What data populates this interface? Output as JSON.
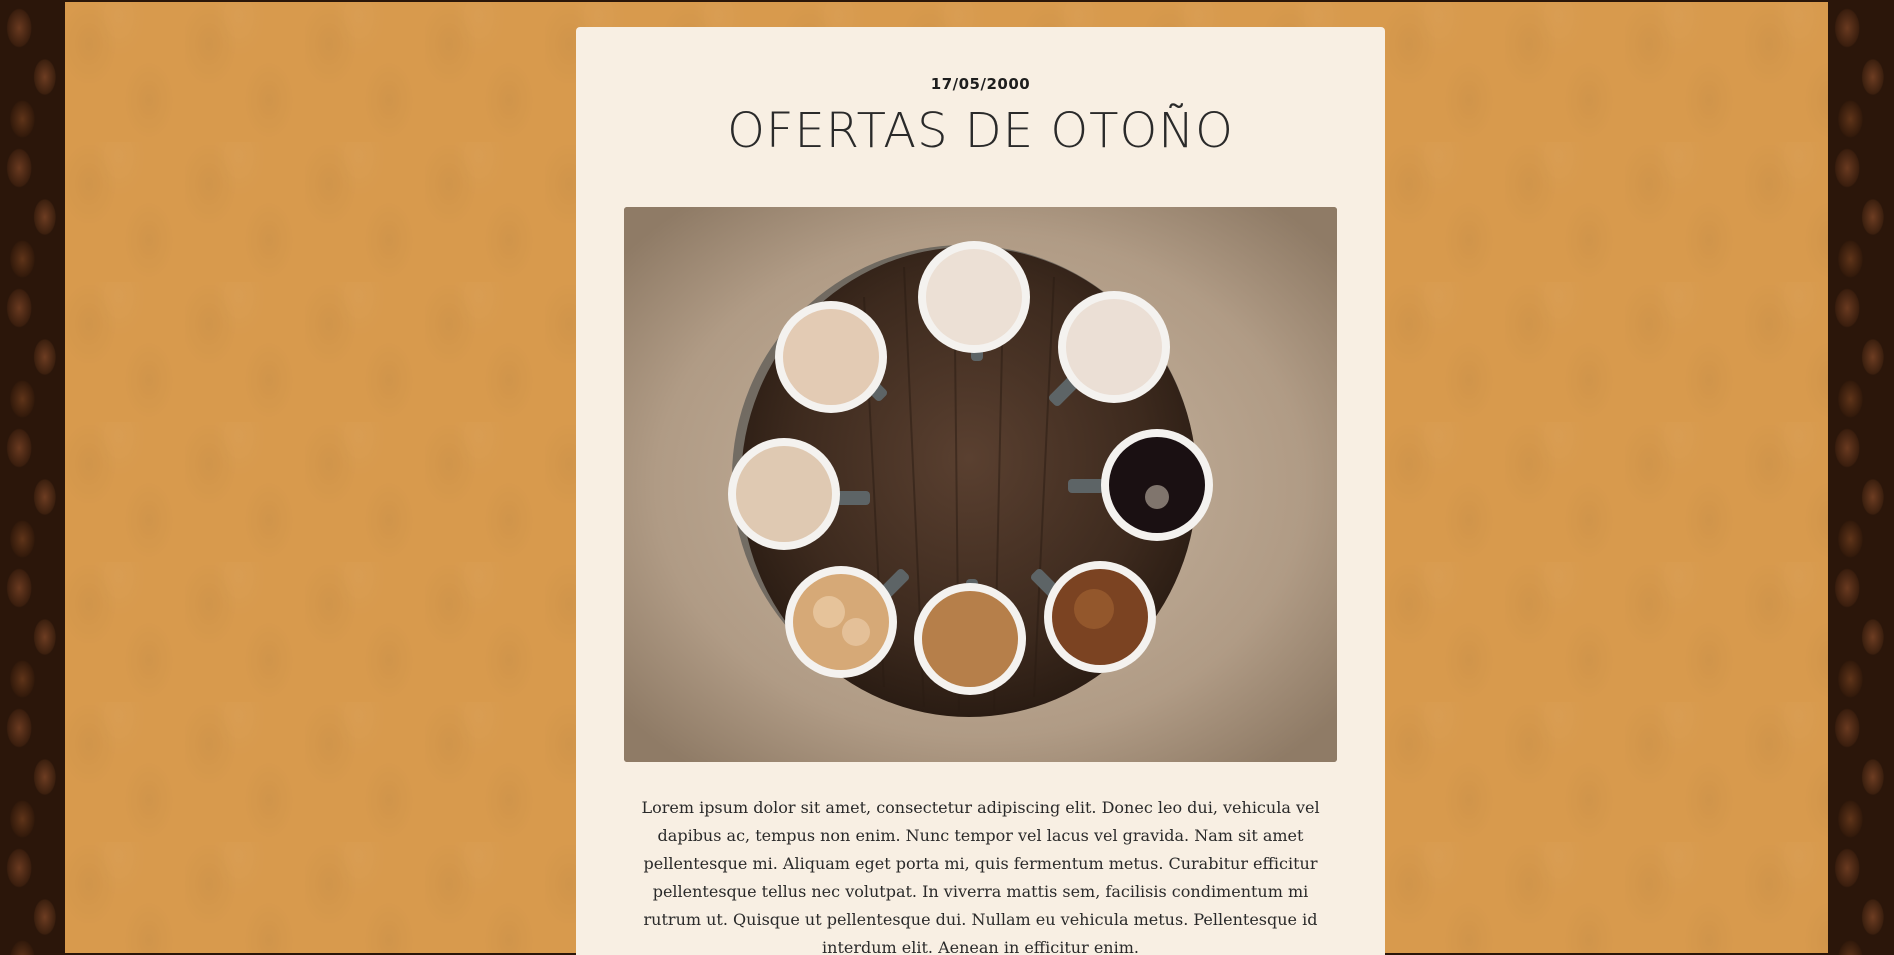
{
  "post": {
    "date": "17/05/2000",
    "title": "OFERTAS DE OTOÑO",
    "image_alt": "Tazas de café sobre una mesa de madera",
    "body": "Lorem ipsum dolor sit amet, consectetur adipiscing elit. Donec leo dui, vehicula vel dapibus ac, tempus non enim. Nunc tempor vel lacus vel gravida. Nam sit amet pellentesque mi. Aliquam eget porta mi, quis fermentum metus. Curabitur efficitur pellentesque tellus nec volutpat. In viverra mattis sem, facilisis condimentum mi rutrum ut. Quisque ut pellentesque dui. Nullam eu vehicula metus. Pellentesque id interdum elit. Aenean in efficitur enim."
  },
  "colors": {
    "panel": "#d89a4d",
    "card": "#f8efe3",
    "text": "#2a2a2a",
    "beans": "#2a1609"
  }
}
